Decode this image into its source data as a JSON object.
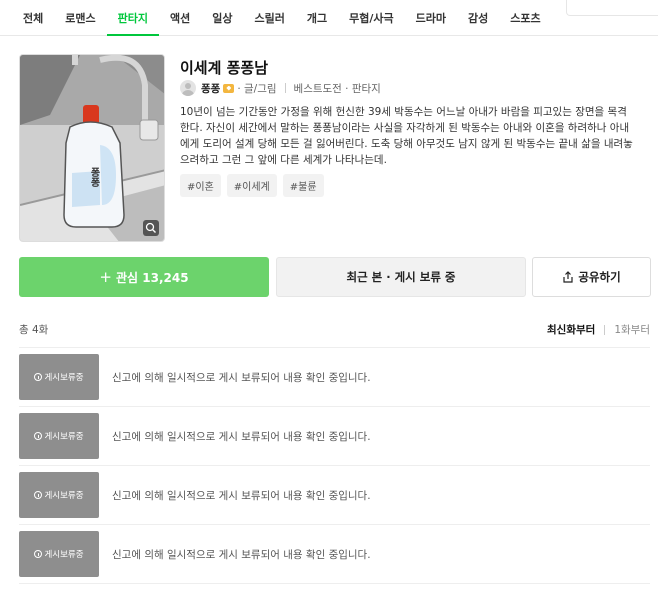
{
  "nav": {
    "tabs": [
      {
        "label": "전체"
      },
      {
        "label": "로맨스"
      },
      {
        "label": "판타지"
      },
      {
        "label": "액션"
      },
      {
        "label": "일상"
      },
      {
        "label": "스릴러"
      },
      {
        "label": "개그"
      },
      {
        "label": "무협/사극"
      },
      {
        "label": "드라마"
      },
      {
        "label": "감성"
      },
      {
        "label": "스포츠"
      }
    ],
    "active_tab": "판타지",
    "accent_color": "#00c73c"
  },
  "webtoon": {
    "title": "이세계 퐁퐁남",
    "author": "퐁퐁",
    "role": "· 글/그림",
    "category": "베스트도전 · 판타지",
    "thumbnail_text": "퐁퐁",
    "description": "10년이 넘는 기간동안 가정을 위해 헌신한 39세 박동수는 어느날 아내가 바람을 피고있는 장면을 목격한다. 자신이 세간에서 말하는 퐁퐁남이라는 사실을 자각하게 된 박동수는 아내와 이혼을 하려하나 아내에게 도리어 설계 당해 모든 걸 잃어버린다. 도축 당해 아무것도 남지 않게 된 박동수는 끝내 삶을 내려놓으려하고 그런 그 앞에 다른 세계가 나타나는데.",
    "tags": [
      "#이혼",
      "#이세계",
      "#불륜"
    ]
  },
  "actions": {
    "favorite_label": "관심 13,245",
    "favorite_count": 13245,
    "favorite_color": "#6cd36c",
    "recent_label": "최근 본 · 게시 보류 중",
    "share_label": "공유하기"
  },
  "episodes": {
    "count_label": "총 4화",
    "sort_newest": "최신화부터",
    "sort_oldest": "1화부터",
    "items": [
      {
        "badge": "게시보류중",
        "text": "신고에 의해 일시적으로 게시 보류되어 내용 확인 중입니다."
      },
      {
        "badge": "게시보류중",
        "text": "신고에 의해 일시적으로 게시 보류되어 내용 확인 중입니다."
      },
      {
        "badge": "게시보류중",
        "text": "신고에 의해 일시적으로 게시 보류되어 내용 확인 중입니다."
      },
      {
        "badge": "게시보류중",
        "text": "신고에 의해 일시적으로 게시 보류되어 내용 확인 중입니다."
      }
    ]
  }
}
